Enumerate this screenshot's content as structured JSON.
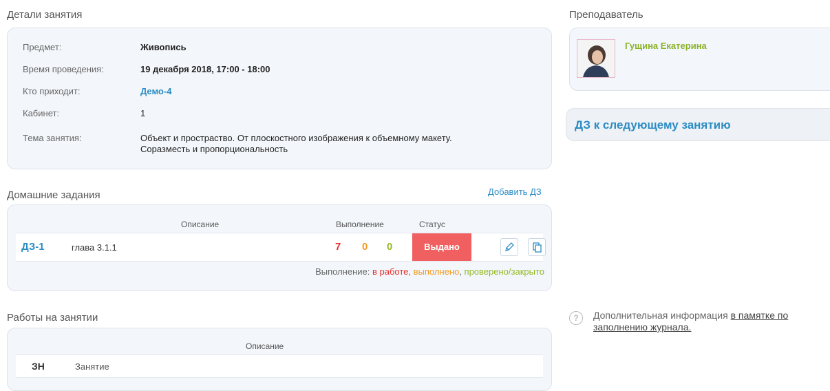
{
  "lesson_details": {
    "title": "Детали занятия",
    "rows": [
      {
        "label": "Предмет:",
        "value": "Живопись"
      },
      {
        "label": "Время проведения:",
        "value": "19 декабря 2018, 17:00 - 18:00"
      },
      {
        "label": "Кто приходит:",
        "value": "Демо-4"
      },
      {
        "label": "Кабинет:",
        "value": "1"
      },
      {
        "label": "Тема занятия:",
        "value_line1": "Объект и простраство. От плоскостного изображения к объемному макету.",
        "value_line2": "Соразместь и пропорциональность"
      }
    ]
  },
  "teacher": {
    "title": "Преподаватель",
    "name": "Гущина Екатерина"
  },
  "next_homework": {
    "title": "ДЗ к следующему занятию"
  },
  "homework": {
    "title": "Домашние задания",
    "add_label": "Добавить ДЗ",
    "columns": {
      "description": "Описание",
      "completion": "Выполнение",
      "status": "Статус"
    },
    "rows": [
      {
        "id": "ДЗ-1",
        "description": "глава 3.1.1",
        "in_progress": "7",
        "done": "0",
        "checked": "0",
        "status": "Выдано"
      }
    ],
    "legend": {
      "prefix": "Выполнение:",
      "in_progress": "в работе",
      "done": "выполнено",
      "checked": "проверено/закрыто",
      "sep": ","
    },
    "colors": {
      "in_progress": "#e5312e",
      "done": "#f29a1f",
      "checked": "#95b924",
      "status": "#f06060"
    }
  },
  "class_work": {
    "title": "Работы на занятии",
    "columns": {
      "description": "Описание"
    },
    "rows": [
      {
        "code": "ЗН",
        "description": "Занятие"
      }
    ]
  },
  "info": {
    "text": "Дополнительная информация",
    "link_line1": "в памятке по",
    "link_line2": "заполнению журнала."
  }
}
